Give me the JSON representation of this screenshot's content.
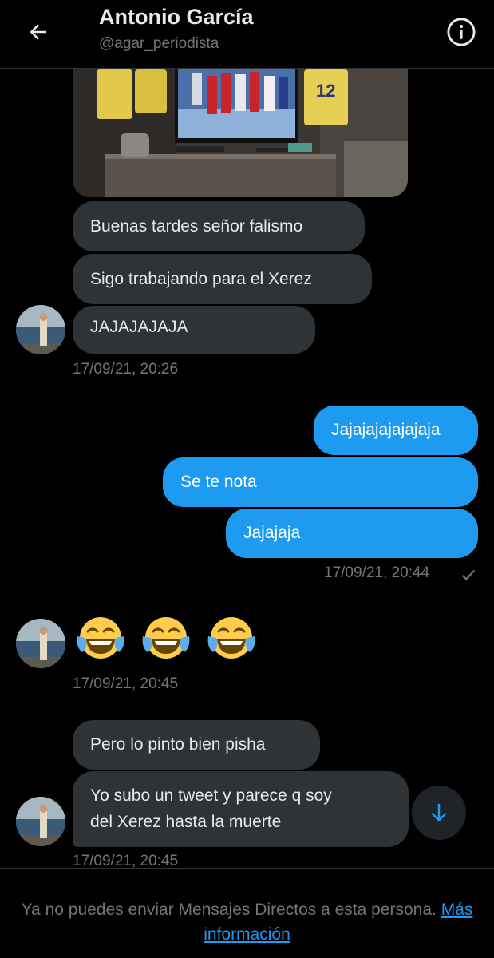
{
  "header": {
    "back_icon": "arrow-left-icon",
    "title": "Antonio García",
    "handle": "@agar_periodista",
    "info_icon": "info-circle-icon"
  },
  "messages": {
    "m1": "Buenas tardes señor falismo",
    "m2": "Sigo trabajando para el Xerez",
    "m3": "JAJAJAJAJA",
    "t1": "17/09/21, 20:26",
    "m4": "Jajajajajajajaja",
    "m5": "Se te nota",
    "m6": "Jajajaja",
    "t2": "17/09/21, 20:44",
    "m7": "😂😂😂",
    "t3": "17/09/21, 20:45",
    "m8": "Pero lo pinto bien pisha",
    "m9_line1": "Yo subo un tweet y parece q soy",
    "m9_line2": "del Xerez hasta la muerte",
    "t4": "17/09/21, 20:45"
  },
  "scroll_icon": "arrow-down-icon",
  "footer": {
    "text_before": "Ya no puedes enviar Mensajes Directos a esta persona.",
    "link": "Más información"
  },
  "colors": {
    "background": "#000000",
    "incoming_bubble": "#2f3336",
    "outgoing_bubble": "#1d9bf0",
    "secondary_text": "#71767b",
    "link": "#1d9bf0"
  }
}
